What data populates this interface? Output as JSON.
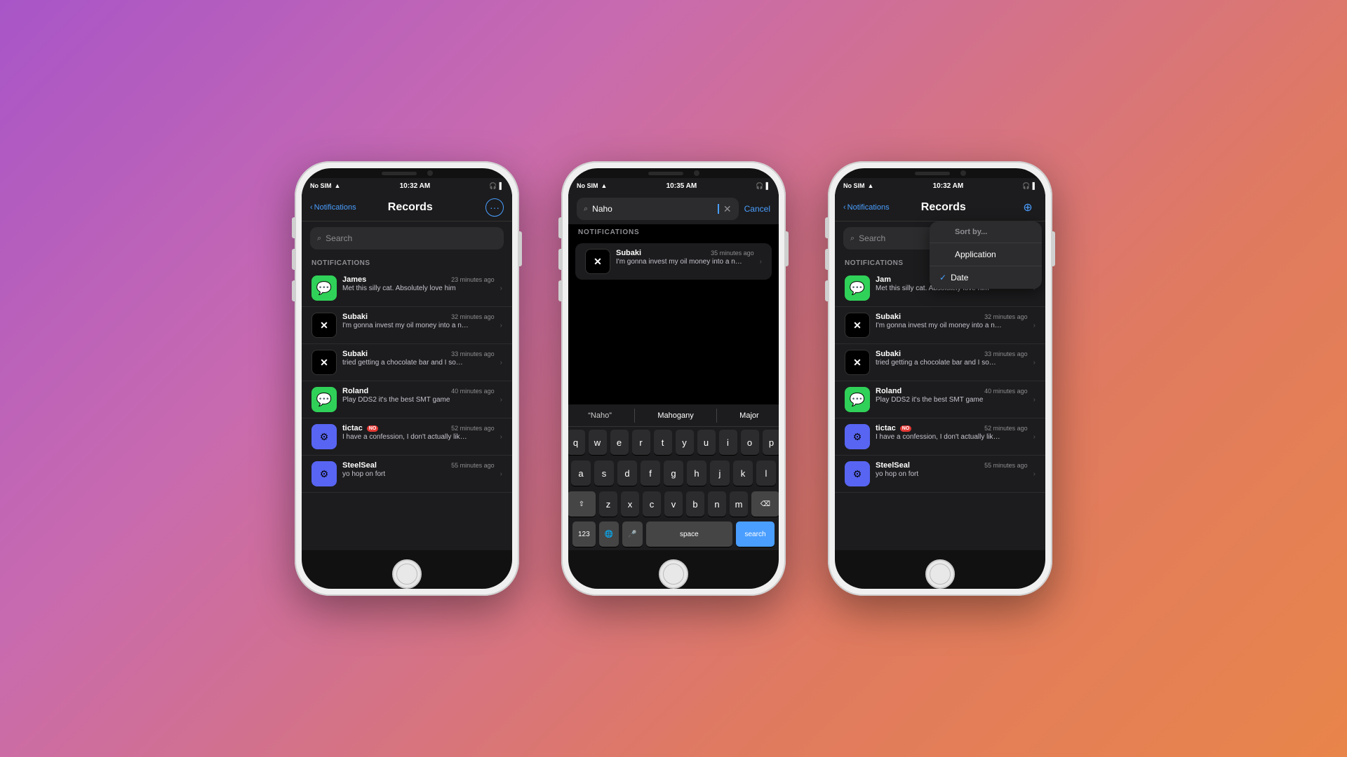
{
  "background": {
    "gradient": "linear-gradient(135deg, #a855c8 0%, #c86ab0 30%, #e07a60 70%, #e8854a 100%)"
  },
  "phone1": {
    "status": {
      "carrier": "No SIM",
      "time": "10:32 AM",
      "battery": "🔋"
    },
    "nav": {
      "back_label": "Notifications",
      "title": "Records",
      "icon": "···"
    },
    "search_placeholder": "Search",
    "section_label": "NOTIFICATIONS",
    "notifications": [
      {
        "app": "James",
        "icon_type": "messages",
        "time": "23 minutes ago",
        "text": "Met this silly cat. Absolutely love him"
      },
      {
        "app": "Subaki",
        "icon_type": "x",
        "time": "32 minutes ago",
        "text": "I'm gonna invest my oil money into a nahobino sculpture"
      },
      {
        "app": "Subaki",
        "icon_type": "x",
        "time": "33 minutes ago",
        "text": "tried getting a chocolate bar and I somehow cracked my back?? anyw..."
      },
      {
        "app": "Roland",
        "icon_type": "messages",
        "time": "40 minutes ago",
        "text": "Play DDS2 it's the best SMT game"
      },
      {
        "app": "tictac",
        "icon_type": "discord",
        "time": "52 minutes ago",
        "text": "I have a confession, I don't actually like shinj...",
        "badge": "NO"
      },
      {
        "app": "SteelSeal",
        "icon_type": "discord",
        "time": "55 minutes ago",
        "text": "yo hop on fort"
      }
    ]
  },
  "phone2": {
    "status": {
      "carrier": "No SIM",
      "time": "10:35 AM",
      "battery": "🔋"
    },
    "search_value": "Naho",
    "cancel_label": "Cancel",
    "section_label": "NOTIFICATIONS",
    "result": {
      "app": "Subaki",
      "icon_type": "x",
      "time": "35 minutes ago",
      "text": "I'm gonna invest my oil money into a nahobino sculpture"
    },
    "autocomplete": [
      "\"Naho\"",
      "Mahogany",
      "Major"
    ],
    "keyboard_rows": [
      [
        "q",
        "w",
        "e",
        "r",
        "t",
        "y",
        "u",
        "i",
        "o",
        "p"
      ],
      [
        "a",
        "s",
        "d",
        "f",
        "g",
        "h",
        "j",
        "k",
        "l"
      ],
      [
        "z",
        "x",
        "c",
        "v",
        "b",
        "n",
        "m"
      ],
      [
        "123",
        "🌐",
        "🎤",
        "space",
        "search"
      ]
    ]
  },
  "phone3": {
    "status": {
      "carrier": "No SIM",
      "time": "10:32 AM",
      "battery": "🔋"
    },
    "nav": {
      "back_label": "Notifications",
      "title": "Records",
      "icon": "⊕"
    },
    "search_placeholder": "Search",
    "section_label": "NOTIFICATIONS",
    "notifications": [
      {
        "app": "Jam",
        "icon_type": "messages",
        "time": "23 minutes ago",
        "text": "Met this silly cat. Absolutely love him"
      },
      {
        "app": "Subaki",
        "icon_type": "x",
        "time": "32 minutes ago",
        "text": "I'm gonna invest my oil money into a nahobino sculpture"
      },
      {
        "app": "Subaki",
        "icon_type": "x",
        "time": "33 minutes ago",
        "text": "tried getting a chocolate bar and I somehow cracked my back?? anyw..."
      },
      {
        "app": "Roland",
        "icon_type": "messages",
        "time": "40 minutes ago",
        "text": "Play DDS2 it's the best SMT game"
      },
      {
        "app": "tictac",
        "icon_type": "discord",
        "time": "52 minutes ago",
        "text": "I have a confession, I don't actually like shinj...",
        "badge": "NO"
      },
      {
        "app": "SteelSeal",
        "icon_type": "discord",
        "time": "55 minutes ago",
        "text": "yo hop on fort"
      }
    ],
    "dropdown": {
      "items": [
        {
          "label": "Sort by...",
          "type": "header"
        },
        {
          "label": "Application",
          "type": "item"
        },
        {
          "label": "Date",
          "type": "item",
          "checked": true
        }
      ]
    }
  }
}
